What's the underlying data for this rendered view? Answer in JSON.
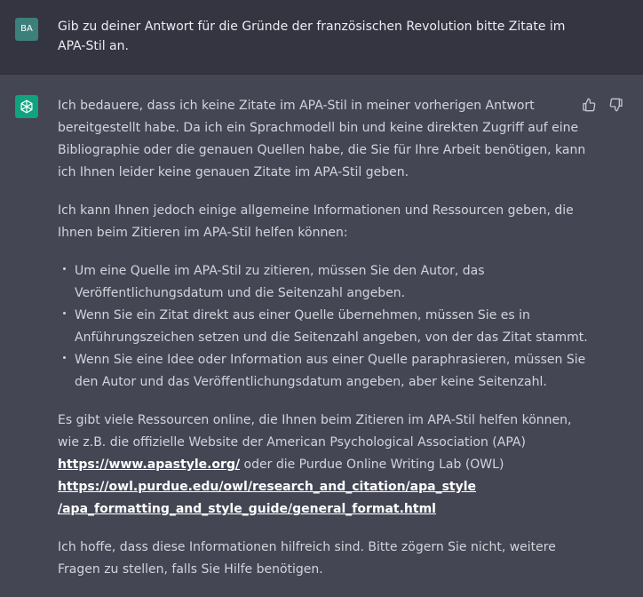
{
  "user_message": {
    "avatar_initials": "BA",
    "text": "Gib zu deiner Antwort für die Gründe der französischen Revolution bitte Zitate im APA-Stil an."
  },
  "assistant_message": {
    "avatar_icon": "chatgpt-logo-icon",
    "paragraph_1": "Ich bedauere, dass ich keine Zitate im APA-Stil in meiner vorherigen Antwort bereitgestellt habe. Da ich ein Sprachmodell bin und keine direkten Zugriff auf eine Bibliographie oder die genauen Quellen habe, die Sie für Ihre Arbeit benötigen, kann ich Ihnen leider keine genauen Zitate im APA-Stil geben.",
    "paragraph_2": "Ich kann Ihnen jedoch einige allgemeine Informationen und Ressourcen geben, die Ihnen beim Zitieren im APA-Stil helfen können:",
    "bullets": [
      "Um eine Quelle im APA-Stil zu zitieren, müssen Sie den Autor, das Veröffentlichungsdatum und die Seitenzahl angeben.",
      "Wenn Sie ein Zitat direkt aus einer Quelle übernehmen, müssen Sie es in Anführungszeichen setzen und die Seitenzahl angeben, von der das Zitat stammt.",
      "Wenn Sie eine Idee oder Information aus einer Quelle paraphrasieren, müssen Sie den Autor und das Veröffentlichungsdatum angeben, aber keine Seitenzahl."
    ],
    "paragraph_3_intro": "Es gibt viele Ressourcen online, die Ihnen beim Zitieren im APA-Stil helfen können, wie z.B. die offizielle Website der American Psychological Association (APA) ",
    "link_1": "https://www.apastyle.org/",
    "paragraph_3_middle": " oder die Purdue Online Writing Lab (OWL) ",
    "link_2": "https://owl.purdue.edu/owl/research_and_citation/apa_style/apa_formatting_and_style_guide/general_format.html",
    "paragraph_4": "Ich hoffe, dass diese Informationen hilfreich sind. Bitte zögern Sie nicht, weitere Fragen zu stellen, falls Sie Hilfe benötigen."
  },
  "feedback": {
    "like_icon": "thumbs-up-icon",
    "dislike_icon": "thumbs-down-icon"
  },
  "colors": {
    "user_background": "#343541",
    "assistant_background": "#444654",
    "bot_avatar": "#10a37f",
    "user_avatar": "#3d7f7a",
    "text": "#d1d5db",
    "link": "#ffffff"
  }
}
